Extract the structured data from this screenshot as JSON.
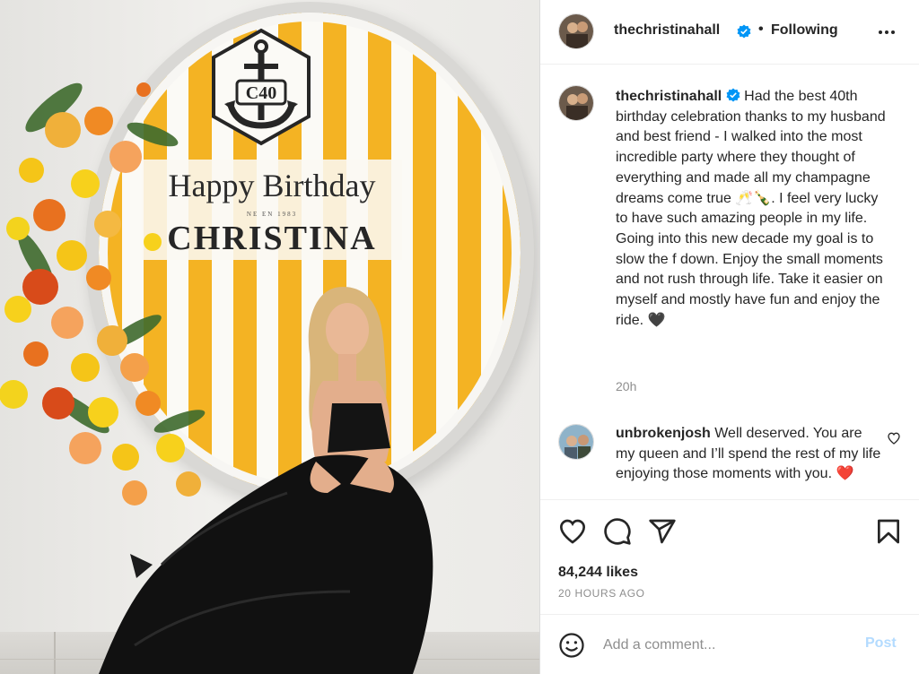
{
  "photo": {
    "sign_badge_text": "C40",
    "sign_line1": "Happy Birthday",
    "sign_small": "NE EN 1983",
    "sign_name": "CHRISTINA"
  },
  "post": {
    "author": "thechristinahall",
    "follow_state": "Following",
    "separator": "•",
    "caption": "Had the best 40th birthday celebration thanks to my husband and best friend - I walked into the most incredible party where they thought of everything and made all my champagne dreams come true 🥂🍾. I feel very lucky to have such amazing people in my life. Going into this new decade my goal is to slow the f down. Enjoy the small moments and not rush through life. Take it easier on myself and mostly have fun and enjoy the ride. 🖤",
    "caption_time": "20h",
    "likes": "84,244 likes",
    "posted_ago": "20 HOURS AGO"
  },
  "comments": [
    {
      "user": "unbrokenjosh",
      "text": "Well deserved. You are my queen and I’ll spend the rest of my life enjoying those moments with you. ❤️"
    }
  ],
  "composer": {
    "placeholder": "Add a comment...",
    "post_label": "Post"
  },
  "icons": {
    "verified": "verified-badge-icon",
    "more": "more-options-icon",
    "like": "heart-icon",
    "comment": "comment-icon",
    "share": "share-icon",
    "save": "bookmark-icon",
    "emoji": "emoji-icon"
  },
  "colors": {
    "verified_blue": "#0095f6",
    "sign_yellow": "#f4b323",
    "post_disabled": "#b3dbff",
    "muted_text": "#8e8e8e"
  }
}
